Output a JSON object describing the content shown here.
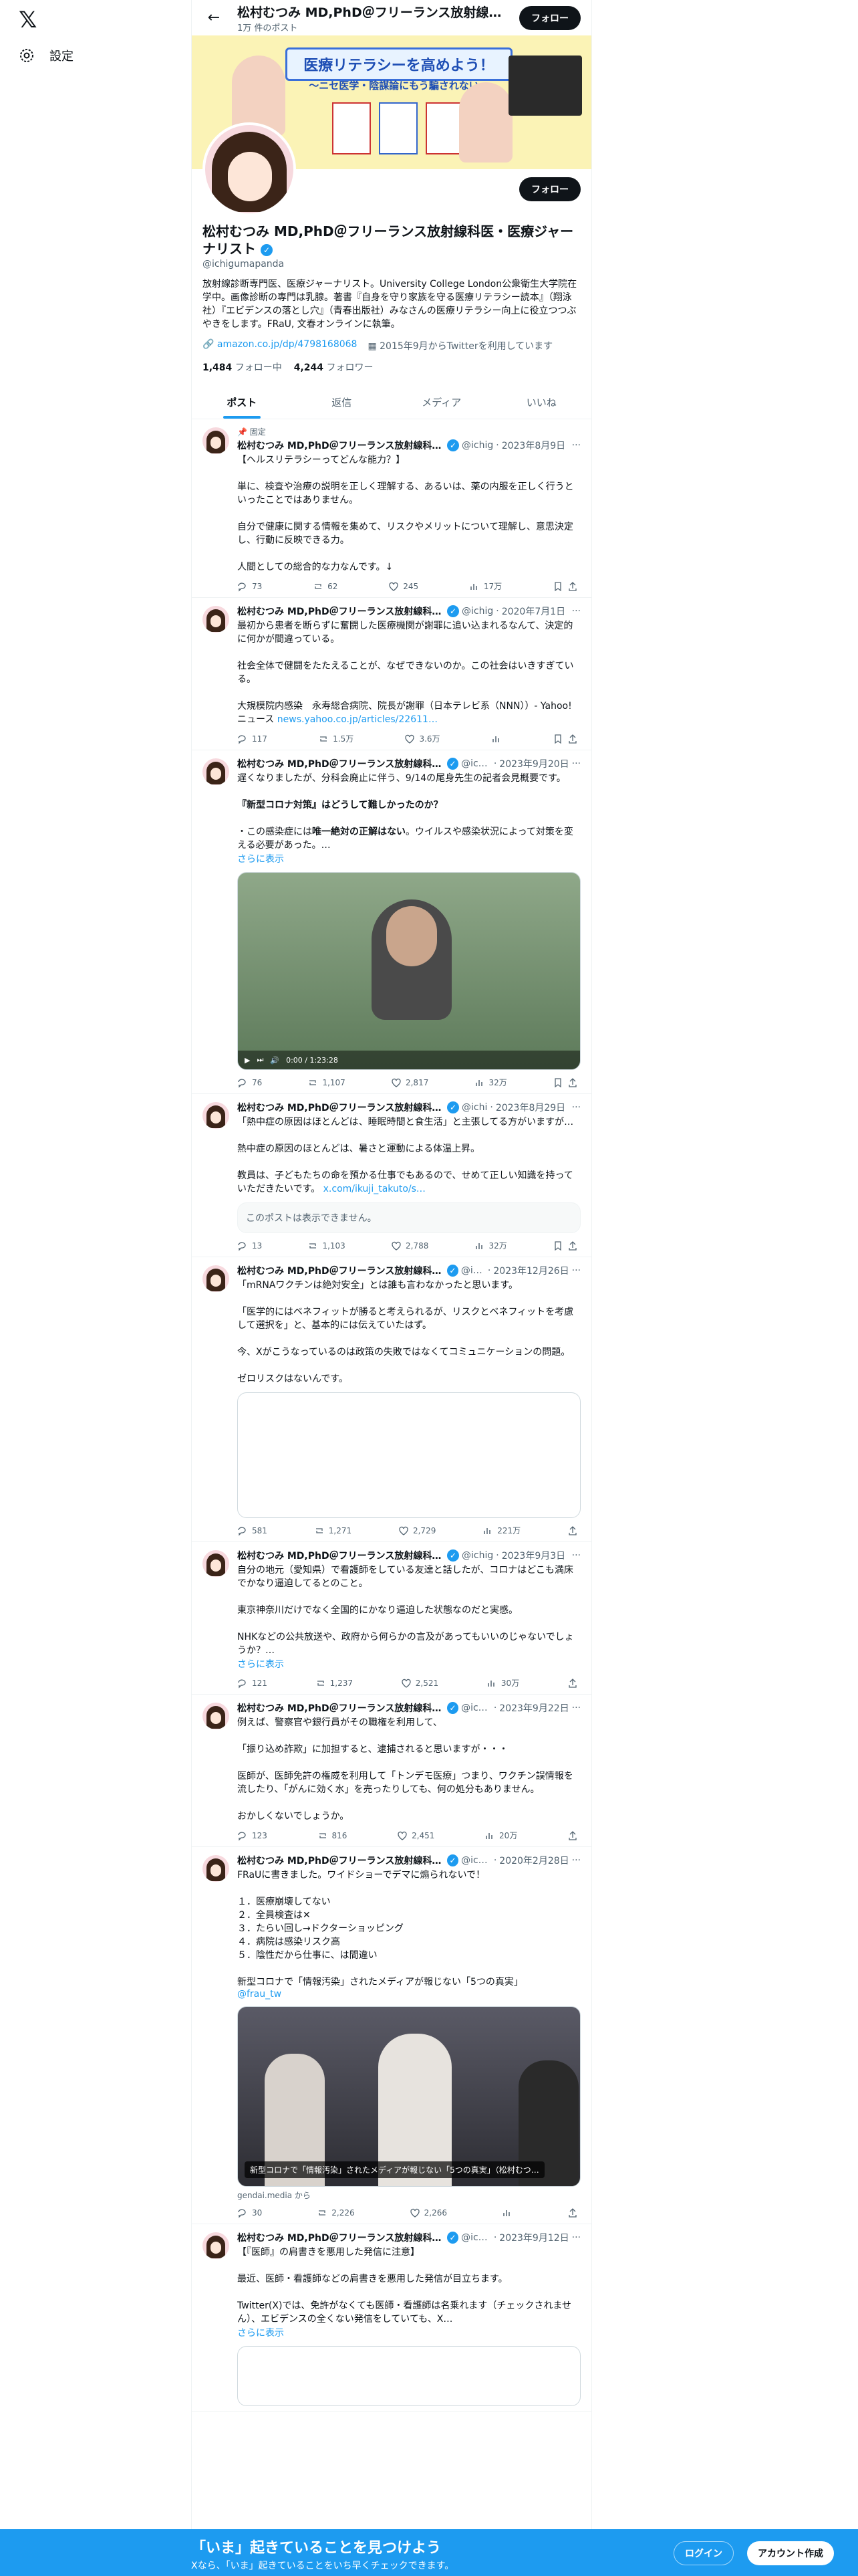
{
  "nav": {
    "logo": "𝕏",
    "settings_label": "設定"
  },
  "header": {
    "name": "松村むつみ MD,PhD＠フリーランス放射線科医・医療ジャーナリスト",
    "post_count": "1万 件のポスト",
    "follow_label": "フォロー"
  },
  "banner": {
    "title": "医療リテラシーを高めよう！",
    "subtitle": "～ニセ医学・陰謀論にもう騙されない～"
  },
  "profile": {
    "display_name": "松村むつみ MD,PhD＠フリーランス放射線科医・医療ジャーナリスト",
    "handle": "@ichigumapanda",
    "follow_label": "フォロー",
    "bio": "放射線診断専門医、医療ジャーナリスト。University College London公衆衛生大学院在学中。画像診断の専門は乳腺。著書『自身を守り家族を守る医療リテラシー読本』（翔泳社）『エビデンスの落とし穴』（青春出版社）みなさんの医療リテラシー向上に役立つつぶやきをします。FRaU, 文春オンラインに執筆。",
    "link": "amazon.co.jp/dp/4798168068",
    "joined": "2015年9月からTwitterを利用しています",
    "following_count": "1,484",
    "following_label": "フォロー中",
    "followers_count": "4,244",
    "followers_label": "フォロワー"
  },
  "tabs": [
    {
      "label": "ポスト"
    },
    {
      "label": "返信"
    },
    {
      "label": "メディア"
    },
    {
      "label": "いいね"
    }
  ],
  "tweets": [
    {
      "pinned": "固定",
      "name": "松村むつみ MD,PhD＠フリーランス放射線科医・医療ジャーナリスト",
      "handle": "@ichig",
      "date": "2023年8月9日",
      "text": "【ヘルスリテラシーってどんな能力？】\n\n単に、検査や治療の説明を正しく理解する、あるいは、薬の内服を正しく行うといったことではありません。\n\n自分で健康に関する情報を集めて、リスクやメリットについて理解し、意思決定し、行動に反映できる力。\n\n人間としての総合的な力なんです。↓",
      "replies": "73",
      "reposts": "62",
      "likes": "245",
      "views": "17万"
    },
    {
      "name": "松村むつみ MD,PhD＠フリーランス放射線科医・医療ジャーナリスト",
      "handle": "@ichig",
      "date": "2020年7月1日",
      "text": "最初から患者を断らずに奮闘した医療機関が謝罪に追い込まれるなんて、決定的に何かが間違っている。\n\n社会全体で健闘をたたえることが、なぜできないのか。この社会はいきすぎている。\n\n大規模院内感染　永寿総合病院、院長が謝罪（日本テレビ系（NNN））- Yahoo!ニュース",
      "link": "news.yahoo.co.jp/articles/22611…",
      "replies": "117",
      "reposts": "1.5万",
      "likes": "3.6万"
    },
    {
      "name": "松村むつみ MD,PhD＠フリーランス放射線科医・医療ジャーナリスト",
      "handle": "@ichig",
      "date": "2023年9月20日",
      "text_a": "遅くなりましたが、分科会廃止に伴う、9/14の尾身先生の記者会見概要です。",
      "text_b": "『新型コロナ対策』はどうして難しかったのか？",
      "text_c_prefix": "・この感染症には",
      "text_c_bold": "唯一絶対の正解はない",
      "text_c_suffix": "。ウイルスや感染状況によって対策を変える必要があった。…",
      "show_more": "さらに表示",
      "video_time": "0:00 / 1:23:28",
      "replies": "76",
      "reposts": "1,107",
      "likes": "2,817",
      "views": "32万"
    },
    {
      "name": "松村むつみ MD,PhD＠フリーランス放射線科医・医療ジャーナリスト",
      "handle": "@ichi",
      "date": "2023年8月29日",
      "text": "「熱中症の原因はほとんどは、睡眠時間と食生活」と主張してる方がいますが…\n\n熱中症の原因のほとんどは、暑さと運動による体温上昇。\n\n教員は、子どもたちの命を預かる仕事でもあるので、せめて正しい知識を持っていただきたいです。",
      "link": "x.com/ikuji_takuto/s…",
      "unavailable": "このポストは表示できません。",
      "replies": "13",
      "reposts": "1,103",
      "likes": "2,788",
      "views": "32万"
    },
    {
      "name": "松村むつみ MD,PhD＠フリーランス放射線科医・医療ジャーナリスト",
      "handle": "@ichi",
      "date": "2023年12月26日",
      "text": "「mRNAワクチンは絶対安全」とは誰も言わなかったと思います。\n\n「医学的にはベネフィットが勝ると考えられるが、リスクとベネフィットを考慮して選択を」と、基本的には伝えていたはず。\n\n今、Xがこうなっているのは政策の失敗ではなくてコミュニケーションの問題。\n\nゼロリスクはないんです。",
      "replies": "581",
      "reposts": "1,271",
      "likes": "2,729",
      "views": "221万"
    },
    {
      "name": "松村むつみ MD,PhD＠フリーランス放射線科医・医療ジャーナリスト",
      "handle": "@ichig",
      "date": "2023年9月3日",
      "text": "自分の地元（愛知県）で看護師をしている友達と話したが、コロナはどこも満床でかなり逼迫してるとのこと。\n\n東京神奈川だけでなく全国的にかなり逼迫した状態なのだと実感。\n\nNHKなどの公共放送や、政府から何らかの言及があってもいいのじゃないでしょうか？…",
      "show_more": "さらに表示",
      "replies": "121",
      "reposts": "1,237",
      "likes": "2,521",
      "views": "30万"
    },
    {
      "name": "松村むつみ MD,PhD＠フリーランス放射線科医・医療ジャーナリスト",
      "handle": "@ichiu",
      "date": "2023年9月22日",
      "text": "例えば、警察官や銀行員がその職権を利用して、\n\n「振り込め詐欺」に加担すると、逮捕されると思いますが・・・\n\n医師が、医師免許の権威を利用して「トンデモ医療」つまり、ワクチン誤情報を流したり、「がんに効く水」を売ったりしても、何の処分もありません。\n\nおかしくないでしょうか。",
      "replies": "123",
      "reposts": "816",
      "likes": "2,451",
      "views": "20万"
    },
    {
      "name": "松村むつみ MD,PhD＠フリーランス放射線科医・医療ジャーナリスト",
      "handle": "@ichig",
      "date": "2020年2月28日",
      "text": "FRaUに書きました。ワイドショーでデマに煽られないで！\n\n１．医療崩壊してない\n２．全員検査は✕\n３．たらい回し→ドクターショッピング\n４．病院は感染リスク高\n５．陰性だから仕事に、は間違い\n\n新型コロナで「情報汚染」されたメディアが報じない「5つの真実」",
      "mention": "@frau_tw",
      "photo_caption": "新型コロナで「情報汚染」されたメディアが報じない「5つの真実」（松村むつ…",
      "source": "gendai.media から",
      "replies": "30",
      "reposts": "2,226",
      "likes": "2,266"
    },
    {
      "name": "松村むつみ MD,PhD＠フリーランス放射線科医・医療ジャーナリスト",
      "handle": "@ichig",
      "date": "2023年9月12日",
      "text": "【『医師』の肩書きを悪用した発信に注意】\n\n最近、医師・看護師などの肩書きを悪用した発信が目立ちます。\n\nTwitter(X)では、免許がなくても医師・看護師は名乗れます（チェックされません）、エビデンスの全くない発信をしていても、X…",
      "show_more": "さらに表示"
    }
  ],
  "bottom_bar": {
    "title": "「いま」起きていることを見つけよう",
    "subtitle": "Xなら、「いま」起きていることをいち早くチェックできます。",
    "login": "ログイン",
    "signup": "アカウント作成"
  }
}
